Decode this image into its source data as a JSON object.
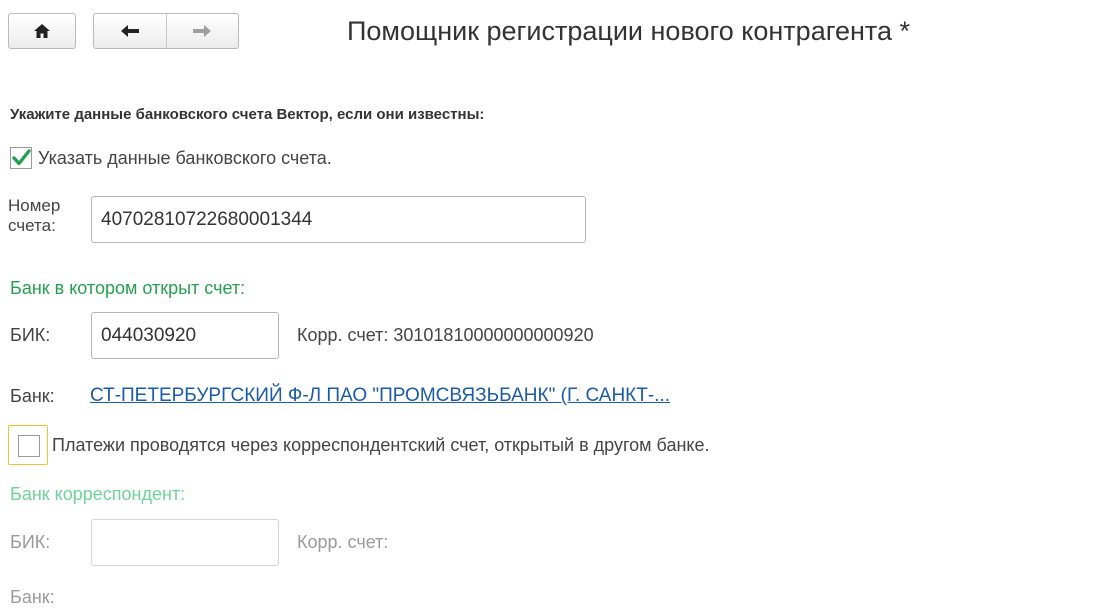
{
  "toolbar": {
    "home_icon": "home-icon",
    "back_icon": "arrow-left-icon",
    "forward_icon": "arrow-right-icon"
  },
  "window": {
    "title": "Помощник регистрации нового контрагента *"
  },
  "form": {
    "section_header": "Укажите данные банковского счета Вектор, если они известны:",
    "specify_account_checkbox": {
      "label": "Указать данные банковского счета.",
      "checked": true
    },
    "account_number": {
      "label_line1": "Номер",
      "label_line2": "счета:",
      "value": "40702810722680001344"
    },
    "bank_group": {
      "header": "Банк в котором открыт счет:",
      "bik_label": "БИК:",
      "bik_value": "044030920",
      "corr_account_label": "Корр. счет:",
      "corr_account_value": "30101810000000000920",
      "bank_label": "Банк:",
      "bank_name": "СТ-ПЕТЕРБУРГСКИЙ Ф-Л ПАО \"ПРОМСВЯЗЬБАНК\" (Г. САНКТ-..."
    },
    "correspondent_checkbox": {
      "label": "Платежи проводятся через корреспондентский счет, открытый в другом банке.",
      "checked": false
    },
    "correspondent_group": {
      "header": "Банк корреспондент:",
      "bik_label": "БИК:",
      "bik_value": "",
      "corr_account_label": "Корр. счет:",
      "bank_label": "Банк:"
    }
  },
  "colors": {
    "accent_green": "#25a04e",
    "disabled_green": "#6fd29a",
    "link_blue": "#1a5aa8",
    "focus_border": "#f2c037"
  }
}
